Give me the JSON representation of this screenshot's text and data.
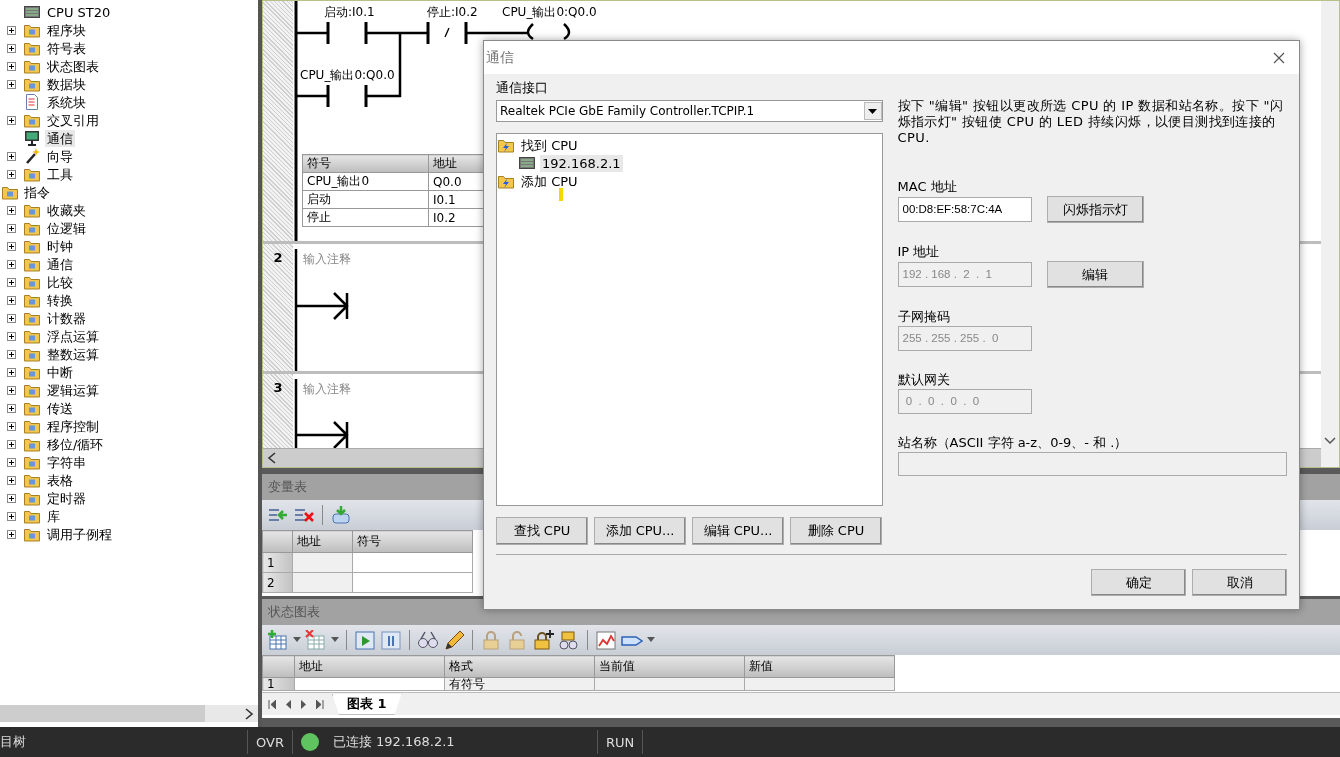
{
  "project_tree": [
    {
      "label": "CPU ST20",
      "kind": "module",
      "selected": false
    },
    {
      "label": "程序块",
      "kind": "folder",
      "expanded": false,
      "selected": false
    },
    {
      "label": "符号表",
      "kind": "folder",
      "expanded": false,
      "selected": false
    },
    {
      "label": "状态图表",
      "kind": "folder",
      "expanded": false,
      "selected": false
    },
    {
      "label": "数据块",
      "kind": "folder",
      "expanded": false,
      "selected": false
    },
    {
      "label": "系统块",
      "kind": "document",
      "selected": false
    },
    {
      "label": "交叉引用",
      "kind": "folder",
      "expanded": false,
      "selected": false
    },
    {
      "label": "通信",
      "kind": "monitor",
      "selected": true
    },
    {
      "label": "向导",
      "kind": "wand",
      "expanded": false,
      "selected": false
    },
    {
      "label": "工具",
      "kind": "folder",
      "expanded": false,
      "selected": false
    }
  ],
  "instruction_tree": {
    "label": "指令",
    "kind": "folder",
    "selected": false,
    "children": [
      {
        "label": "收藏夹",
        "kind": "folder",
        "expanded": false,
        "selected": false
      },
      {
        "label": "位逻辑",
        "kind": "folder",
        "expanded": false,
        "selected": false
      },
      {
        "label": "时钟",
        "kind": "folder",
        "expanded": false,
        "selected": false
      },
      {
        "label": "通信",
        "kind": "folder",
        "expanded": false,
        "selected": false
      },
      {
        "label": "比较",
        "kind": "folder",
        "expanded": false,
        "selected": false
      },
      {
        "label": "转换",
        "kind": "folder",
        "expanded": false,
        "selected": false
      },
      {
        "label": "计数器",
        "kind": "folder",
        "expanded": false,
        "selected": false
      },
      {
        "label": "浮点运算",
        "kind": "folder",
        "expanded": false,
        "selected": false
      },
      {
        "label": "整数运算",
        "kind": "folder",
        "expanded": false,
        "selected": false
      },
      {
        "label": "中断",
        "kind": "folder",
        "expanded": false,
        "selected": false
      },
      {
        "label": "逻辑运算",
        "kind": "folder",
        "expanded": false,
        "selected": false
      },
      {
        "label": "传送",
        "kind": "folder",
        "expanded": false,
        "selected": false
      },
      {
        "label": "程序控制",
        "kind": "folder",
        "expanded": false,
        "selected": false
      },
      {
        "label": "移位/循环",
        "kind": "folder",
        "expanded": false,
        "selected": false
      },
      {
        "label": "字符串",
        "kind": "folder",
        "expanded": false,
        "selected": false
      },
      {
        "label": "表格",
        "kind": "folder",
        "expanded": false,
        "selected": false
      },
      {
        "label": "定时器",
        "kind": "folder",
        "expanded": false,
        "selected": false
      },
      {
        "label": "库",
        "kind": "folder",
        "expanded": false,
        "selected": false
      },
      {
        "label": "调用子例程",
        "kind": "folder",
        "expanded": false,
        "selected": false
      }
    ]
  },
  "editor": {
    "network_1": {
      "elements": [
        {
          "kind": "no",
          "label": "启动:I0.1"
        },
        {
          "kind": "nc",
          "label": "停止:I0.2"
        },
        {
          "kind": "coil",
          "label": "CPU_输出0:Q0.0"
        },
        {
          "kind": "parallel",
          "label": "CPU_输出0:Q0.0"
        }
      ],
      "symbol_table": {
        "columns": [
          "符号",
          "地址"
        ],
        "rows": [
          [
            "CPU_输出0",
            "Q0.0"
          ],
          [
            "启动",
            "I0.1"
          ],
          [
            "停止",
            "I0.2"
          ]
        ]
      }
    },
    "networks": [
      {
        "number": "2",
        "comment": "输入注释"
      },
      {
        "number": "3",
        "comment": "输入注释"
      }
    ]
  },
  "variable_table": {
    "title": "变量表",
    "columns": [
      "地址",
      "符号"
    ],
    "rows": [
      "1",
      "2"
    ]
  },
  "status_chart": {
    "title": "状态图表",
    "columns": [
      "地址",
      "格式",
      "当前值",
      "新值"
    ],
    "rows": [
      {
        "number": "1",
        "format": "有符号"
      }
    ],
    "tabs": [
      {
        "label": "图表 1",
        "selected": true
      }
    ]
  },
  "status_bar": {
    "panel": "目树",
    "mode": "OVR",
    "connected": true,
    "connection": "已连接 192.168.2.1",
    "state": "RUN"
  },
  "dialog": {
    "title": "通信",
    "interface_label": "通信接口",
    "interface": "Realtek PCIe GbE Family Controller.TCPIP.1",
    "cpu_tree": [
      {
        "label": "找到 CPU",
        "children": [
          {
            "label": "192.168.2.1",
            "selected": true
          }
        ]
      },
      {
        "label": "添加 CPU"
      }
    ],
    "list_buttons": [
      "查找 CPU",
      "添加 CPU...",
      "编辑 CPU...",
      "删除 CPU"
    ],
    "description": "按下 \"编辑\" 按钮以更改所选 CPU 的 IP 数据和站名称。按下 \"闪烁指示灯\" 按钮使 CPU 的 LED 持续闪烁，以便目测找到连接的 CPU.",
    "fields": [
      {
        "label": "MAC 地址",
        "value": "00:D8:EF:58:7C:4A",
        "disabled": false,
        "kind": "short",
        "button": "闪烁指示灯"
      },
      {
        "label": "IP 地址",
        "value": "192 . 168 .  2  .  1",
        "disabled": true,
        "kind": "short",
        "button": "编辑"
      },
      {
        "label": "子网掩码",
        "value": "255 . 255 . 255 .  0",
        "disabled": true,
        "kind": "short"
      },
      {
        "label": "默认网关",
        "value": " 0  .  0  .  0  .  0",
        "disabled": true,
        "kind": "short"
      },
      {
        "label": "站名称（ASCII 字符 a-z、0-9、- 和 .）",
        "disabled": true,
        "kind": "wide"
      }
    ],
    "buttons": [
      "确定",
      "取消"
    ]
  }
}
